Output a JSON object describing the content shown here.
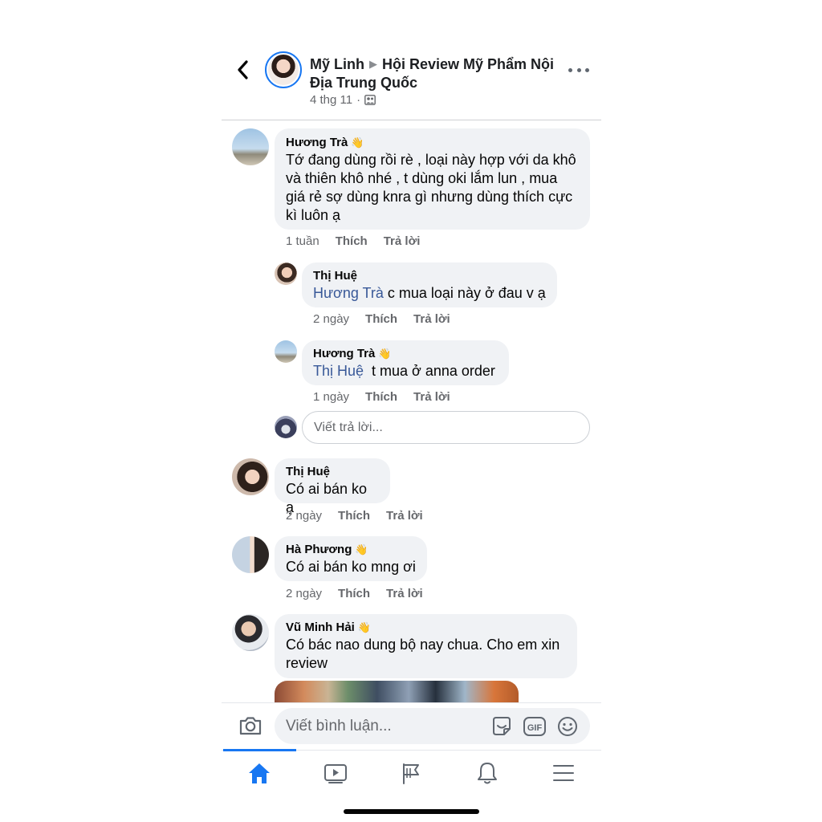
{
  "header": {
    "author": "Mỹ Linh",
    "group": "Hội Review Mỹ Phẩm Nội Địa Trung Quốc",
    "date": "4 thg 11",
    "separator": "·",
    "icons": {
      "back": "chevron-left-icon",
      "privacy": "group-members-icon",
      "more": "more-options-icon"
    }
  },
  "comments": [
    {
      "name": "Hương Trà",
      "text": "Tớ đang dùng rồi rè , loại này hợp với da khô và thiên khô nhé , t dùng oki lắm lun , mua giá rẻ sợ dùng knra gì nhưng dùng thích cực kì luôn ạ",
      "time": "1 tuần",
      "like": "Thích",
      "reply": "Trả lời",
      "replies": [
        {
          "name": "Thị Huệ",
          "mention": "Hương Trà",
          "text": " c mua loại này ở đau v ạ",
          "time": "2 ngày",
          "like": "Thích",
          "reply": "Trả lời"
        },
        {
          "name": "Hương Trà",
          "mention": "Thị Huệ",
          "text": "  t mua ở anna order",
          "time": "1 ngày",
          "like": "Thích",
          "reply": "Trả lời"
        }
      ],
      "reply_placeholder": "Viết trả lời..."
    },
    {
      "name": "Thị Huệ",
      "text": "Có ai bán ko ạ",
      "time": "2 ngày",
      "like": "Thích",
      "reply": "Trả lời"
    },
    {
      "name": "Hà Phương",
      "text": "Có ai bán ko mng ơi",
      "time": "2 ngày",
      "like": "Thích",
      "reply": "Trả lời"
    },
    {
      "name": "Vũ Minh Hải",
      "text": "Có bác nao dung bộ nay chua. Cho em xin review"
    }
  ],
  "composer": {
    "placeholder": "Viết bình luận...",
    "icons": [
      "camera-icon",
      "sticker-icon",
      "gif-icon",
      "emoji-icon"
    ],
    "gif_label": "GIF"
  },
  "tabs": [
    {
      "icon": "home-icon",
      "active": true
    },
    {
      "icon": "watch-icon",
      "active": false
    },
    {
      "icon": "pages-flag-icon",
      "active": false
    },
    {
      "icon": "notifications-bell-icon",
      "active": false
    },
    {
      "icon": "menu-icon",
      "active": false
    }
  ],
  "colors": {
    "accent": "#1877f2",
    "mention": "#385898",
    "bubble": "#f0f2f5",
    "meta": "#65676b"
  }
}
